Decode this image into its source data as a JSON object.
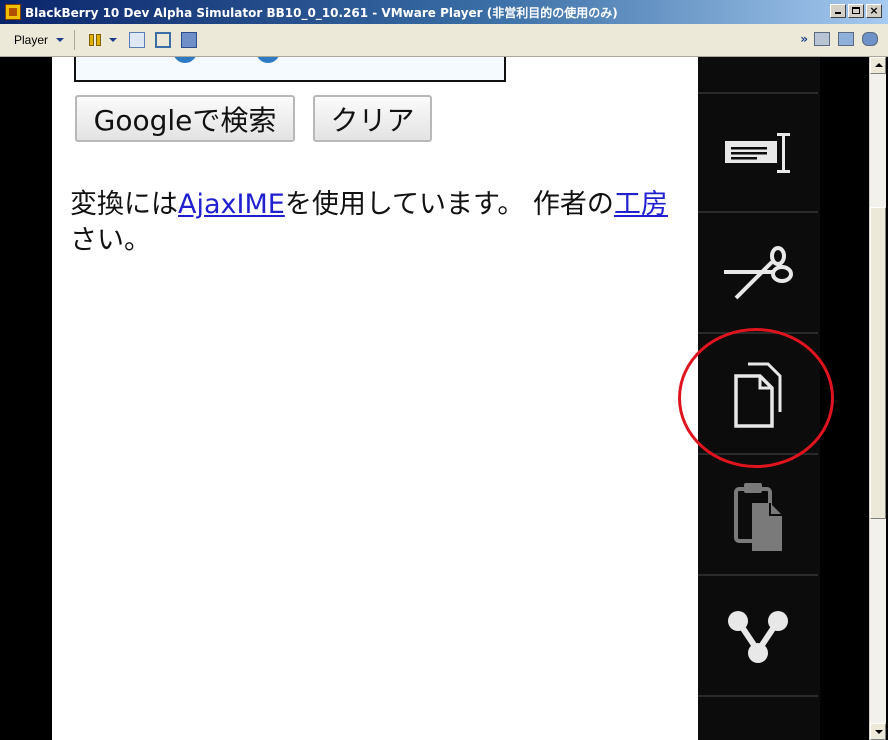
{
  "window": {
    "title": "BlackBerry 10 Dev Alpha Simulator BB10_0_10.261 - VMware Player (非営利目的の使用のみ)",
    "close_glyph": "×"
  },
  "toolbar": {
    "player_label": "Player",
    "overflow_chevron": "»"
  },
  "page": {
    "search_button": "Googleで検索",
    "clear_button": "クリア",
    "paragraph": {
      "before_link": "変換には",
      "link": "AjaxIME",
      "after_link": "を使用しています。 作者の",
      "link2": "工房",
      "line2": "さい。"
    }
  },
  "context_menu": {
    "items": [
      {
        "icon": "select-text-icon"
      },
      {
        "icon": "cut-icon"
      },
      {
        "icon": "copy-icon",
        "highlighted": true
      },
      {
        "icon": "paste-icon",
        "disabled": true
      },
      {
        "icon": "share-icon"
      }
    ],
    "highlight_color": "#e0141e"
  }
}
